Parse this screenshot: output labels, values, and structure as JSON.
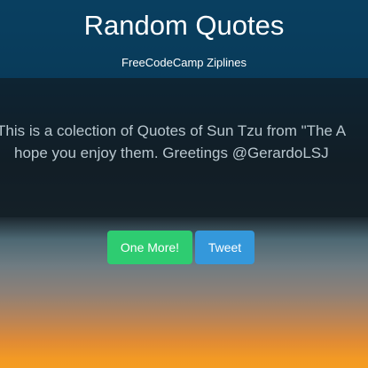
{
  "header": {
    "title": "Random Quotes",
    "subtitle": "FreeCodeCamp Ziplines"
  },
  "quote": {
    "line1": "This is a colection of Quotes of Sun Tzu from \"The A",
    "line2": "hope you enjoy them. Greetings @GerardoLSJ"
  },
  "actions": {
    "more_label": "One More!",
    "tweet_label": "Tweet"
  },
  "colors": {
    "more_button": "#2ecc71",
    "tweet_button": "#3498db",
    "header_bg": "#0d3a55",
    "sunset_orange": "#f39a24"
  }
}
